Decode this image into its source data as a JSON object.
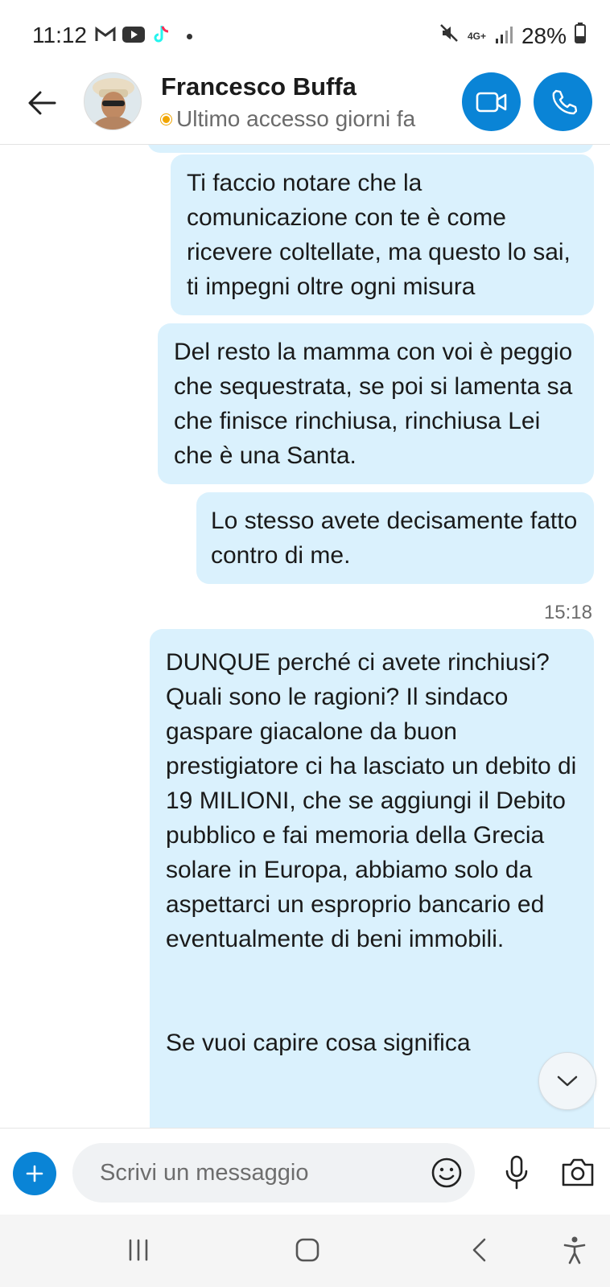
{
  "status_bar": {
    "time": "11:12",
    "network": "4G+",
    "battery": "28%",
    "icons": [
      "gmail-icon",
      "youtube-icon",
      "tiktok-icon",
      "dot-icon",
      "mute-icon",
      "network-icon",
      "signal-icon",
      "battery-icon"
    ]
  },
  "header": {
    "contact_name": "Francesco Buffa",
    "status": "Ultimo accesso giorni fa",
    "presence_color": "#f0a500",
    "accent_color": "#0a84d6"
  },
  "messages": [
    {
      "text": "Ti faccio notare che la comunicazione con te è come ricevere coltellate, ma questo lo sai, ti impegni oltre ogni misura"
    },
    {
      "text": "Del resto la mamma con voi è peggio che sequestrata, se poi si lamenta sa che finisce rinchiusa, rinchiusa Lei che è una Santa."
    },
    {
      "text": "Lo stesso avete decisamente fatto contro di me."
    },
    {
      "text": "DUNQUE perché ci avete rinchiusi? Quali sono le ragioni? Il sindaco gaspare giacalone da buon prestigiatore ci ha lasciato un debito di 19 MILIONI, che se aggiungi il Debito pubblico e fai memoria della Grecia solare in Europa,  abbiamo solo da aspettarci un esproprio bancario ed eventualmente di beni immobili."
    },
    {
      "text": "Se vuoi capire cosa significa"
    }
  ],
  "timestamp": "15:18",
  "bubble_color": "#daf1fd",
  "compose": {
    "placeholder": "Scrivi un messaggio"
  }
}
